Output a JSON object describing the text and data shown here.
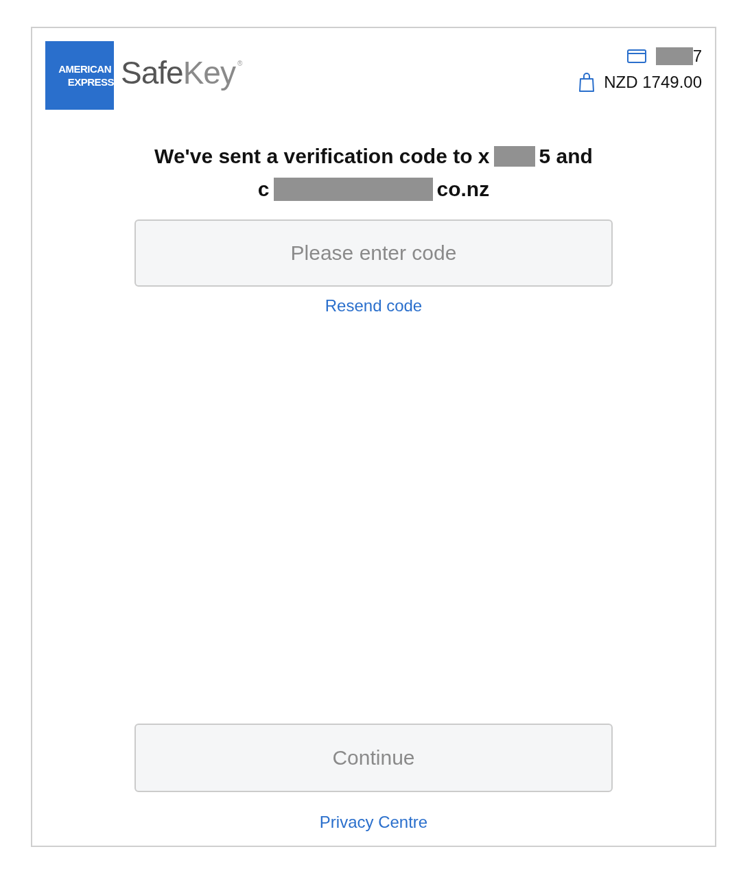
{
  "logo": {
    "line1": "AMERICAN",
    "line2": "EXPRESS"
  },
  "brand": {
    "first": "Safe",
    "second": "Key",
    "mark": "®"
  },
  "summary": {
    "card_suffix": "7",
    "amount": "NZD 1749.00"
  },
  "message": {
    "line1_start": "We've sent a verification code to x",
    "line1_end": "5 and",
    "line2_start": "c",
    "line2_end": "co.nz"
  },
  "code_field": {
    "placeholder": "Please enter code"
  },
  "resend_link": "Resend code",
  "continue_button": {
    "label": "Continue",
    "disabled": true
  },
  "footer_link": "Privacy Centre"
}
